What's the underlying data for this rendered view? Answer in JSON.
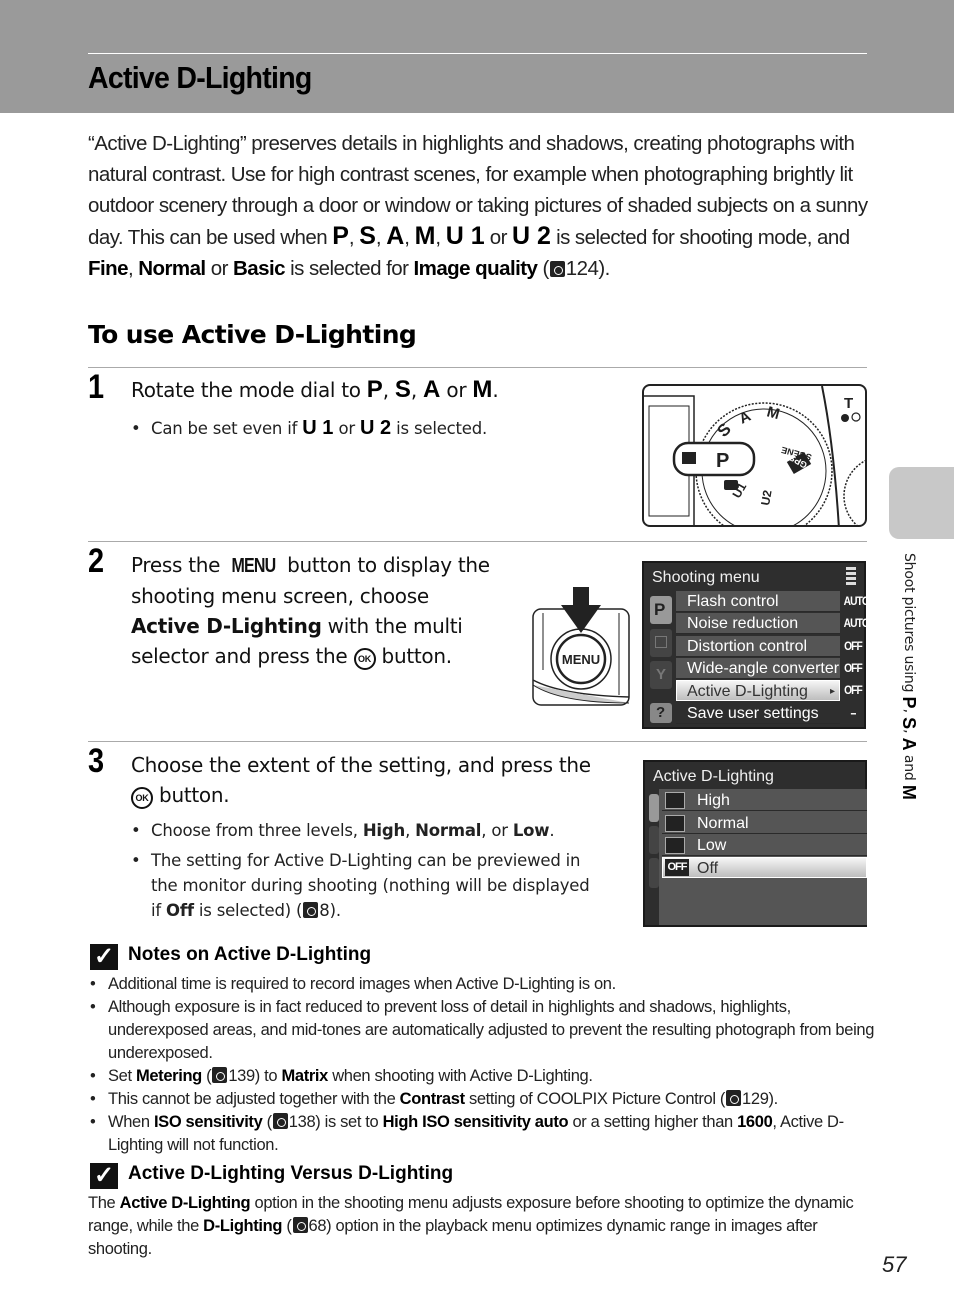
{
  "header": {
    "title": "Active D-Lighting"
  },
  "intro": {
    "text_1": "“Active D-Lighting” preserves details in highlights and shadows, creating photographs with natural contrast. Use for high contrast scenes, for example when photographing brightly lit outdoor scenery through a door or window or taking pictures of shaded subjects on a sunny day. This can be used when ",
    "modes": [
      "P",
      "S",
      "A",
      "M",
      "U 1",
      "U 2"
    ],
    "text_2": " is selected for shooting mode, and ",
    "fine": "Fine",
    "normal": "Normal",
    "or": " or ",
    "basic": "Basic",
    "text_3": " is selected for ",
    "image_quality": "Image quality",
    "ref": "124",
    "ref_icon": "reference-icon"
  },
  "section": {
    "title": "To use Active D-Lighting"
  },
  "steps": [
    {
      "number": "1",
      "text_pre": "Rotate the mode dial to ",
      "modes": [
        "P",
        "S",
        "A",
        "M"
      ],
      "bullet_pre": "Can be set even if ",
      "bullet_modes": [
        "U 1",
        "U 2"
      ],
      "bullet_post": " is selected."
    },
    {
      "number": "2",
      "line1_pre": "Press the ",
      "menu_word": "MENU",
      "line1_post": " button to display the",
      "line2": "shooting menu screen, choose",
      "bold": "Active D-Lighting",
      "line3_post": " with the multi",
      "line4_pre": "selector and press the ",
      "ok_icon": "OK",
      "line4_post": " button."
    },
    {
      "number": "3",
      "line1": "Choose the extent of the setting, and press the",
      "line2_post": " button.",
      "bullets": [
        {
          "pre": "Choose from three levels, ",
          "b1": "High",
          "sep1": ", ",
          "b2": "Normal",
          "sep2": ", or ",
          "b3": "Low",
          "post": "."
        },
        {
          "line1": "The setting for Active D-Lighting can be previewed in",
          "line2": "the monitor during shooting (nothing will be displayed",
          "line3_pre": "if ",
          "bold": "Off",
          "line3_mid": " is selected) (",
          "ref": "8",
          "line3_post": ")."
        }
      ]
    }
  ],
  "dial_figure": {
    "labels": [
      "P",
      "S",
      "A",
      "M",
      "SCENE",
      "GPS",
      "U1",
      "U2",
      "T"
    ]
  },
  "menu_button_figure": {
    "label": "MENU"
  },
  "shooting_menu_screen": {
    "title": "Shooting menu",
    "items": [
      {
        "label": "Flash control",
        "value": "AUTO"
      },
      {
        "label": "Noise reduction",
        "value": "AUTO"
      },
      {
        "label": "Distortion control",
        "value": "OFF"
      },
      {
        "label": "Wide-angle converter",
        "value": "OFF"
      },
      {
        "label": "Active D-Lighting",
        "value": "OFF",
        "selected": true
      },
      {
        "label": "Save user settings",
        "value": "--"
      }
    ],
    "tabs": [
      "P",
      "playback",
      "setup",
      "help"
    ]
  },
  "adl_screen": {
    "title": "Active D-Lighting",
    "options": [
      {
        "label": "High",
        "icon": "adl-high-icon"
      },
      {
        "label": "Normal",
        "icon": "adl-normal-icon"
      },
      {
        "label": "Low",
        "icon": "adl-low-icon"
      },
      {
        "label": "Off",
        "icon": "off-icon",
        "icon_text": "OFF",
        "selected": true
      }
    ]
  },
  "notes": {
    "title": "Notes on Active D-Lighting",
    "items": [
      {
        "text": "Additional time is required to record images when Active D-Lighting is on."
      },
      {
        "text": "Although exposure is in fact reduced to prevent loss of detail in highlights and shadows, highlights, underexposed areas, and mid-tones are automatically adjusted to prevent the resulting photograph from being underexposed."
      },
      {
        "pre": "Set ",
        "b1": "Metering",
        "mid1": " (",
        "ref": "139",
        "mid2": ") to ",
        "b2": "Matrix",
        "post": " when shooting with Active D-Lighting."
      },
      {
        "pre": "This cannot be adjusted together with the ",
        "b1": "Contrast",
        "mid1": " setting of COOLPIX Picture Control (",
        "ref": "129",
        "post": ")."
      },
      {
        "pre": "When ",
        "b1": "ISO sensitivity",
        "mid1": " (",
        "ref": "138",
        "mid2": ") is set to ",
        "b2": "High ISO sensitivity auto",
        "mid3": " or a setting higher than ",
        "b3": "1600",
        "post": ", Active D-Lighting will not function."
      }
    ]
  },
  "versus": {
    "title": "Active D-Lighting Versus D-Lighting",
    "pre": "The ",
    "b1": "Active D-Lighting",
    "mid1": " option in the shooting menu adjusts exposure before shooting to optimize the dynamic range, while the ",
    "b2": "D-Lighting",
    "mid2": " (",
    "ref": "68",
    "post": ") option in the playback menu optimizes dynamic range in images after shooting."
  },
  "side_label": {
    "text": "Shoot pictures using ",
    "modes": [
      "P",
      "S",
      "A",
      "M"
    ],
    "and": " and "
  },
  "page_number": "57"
}
